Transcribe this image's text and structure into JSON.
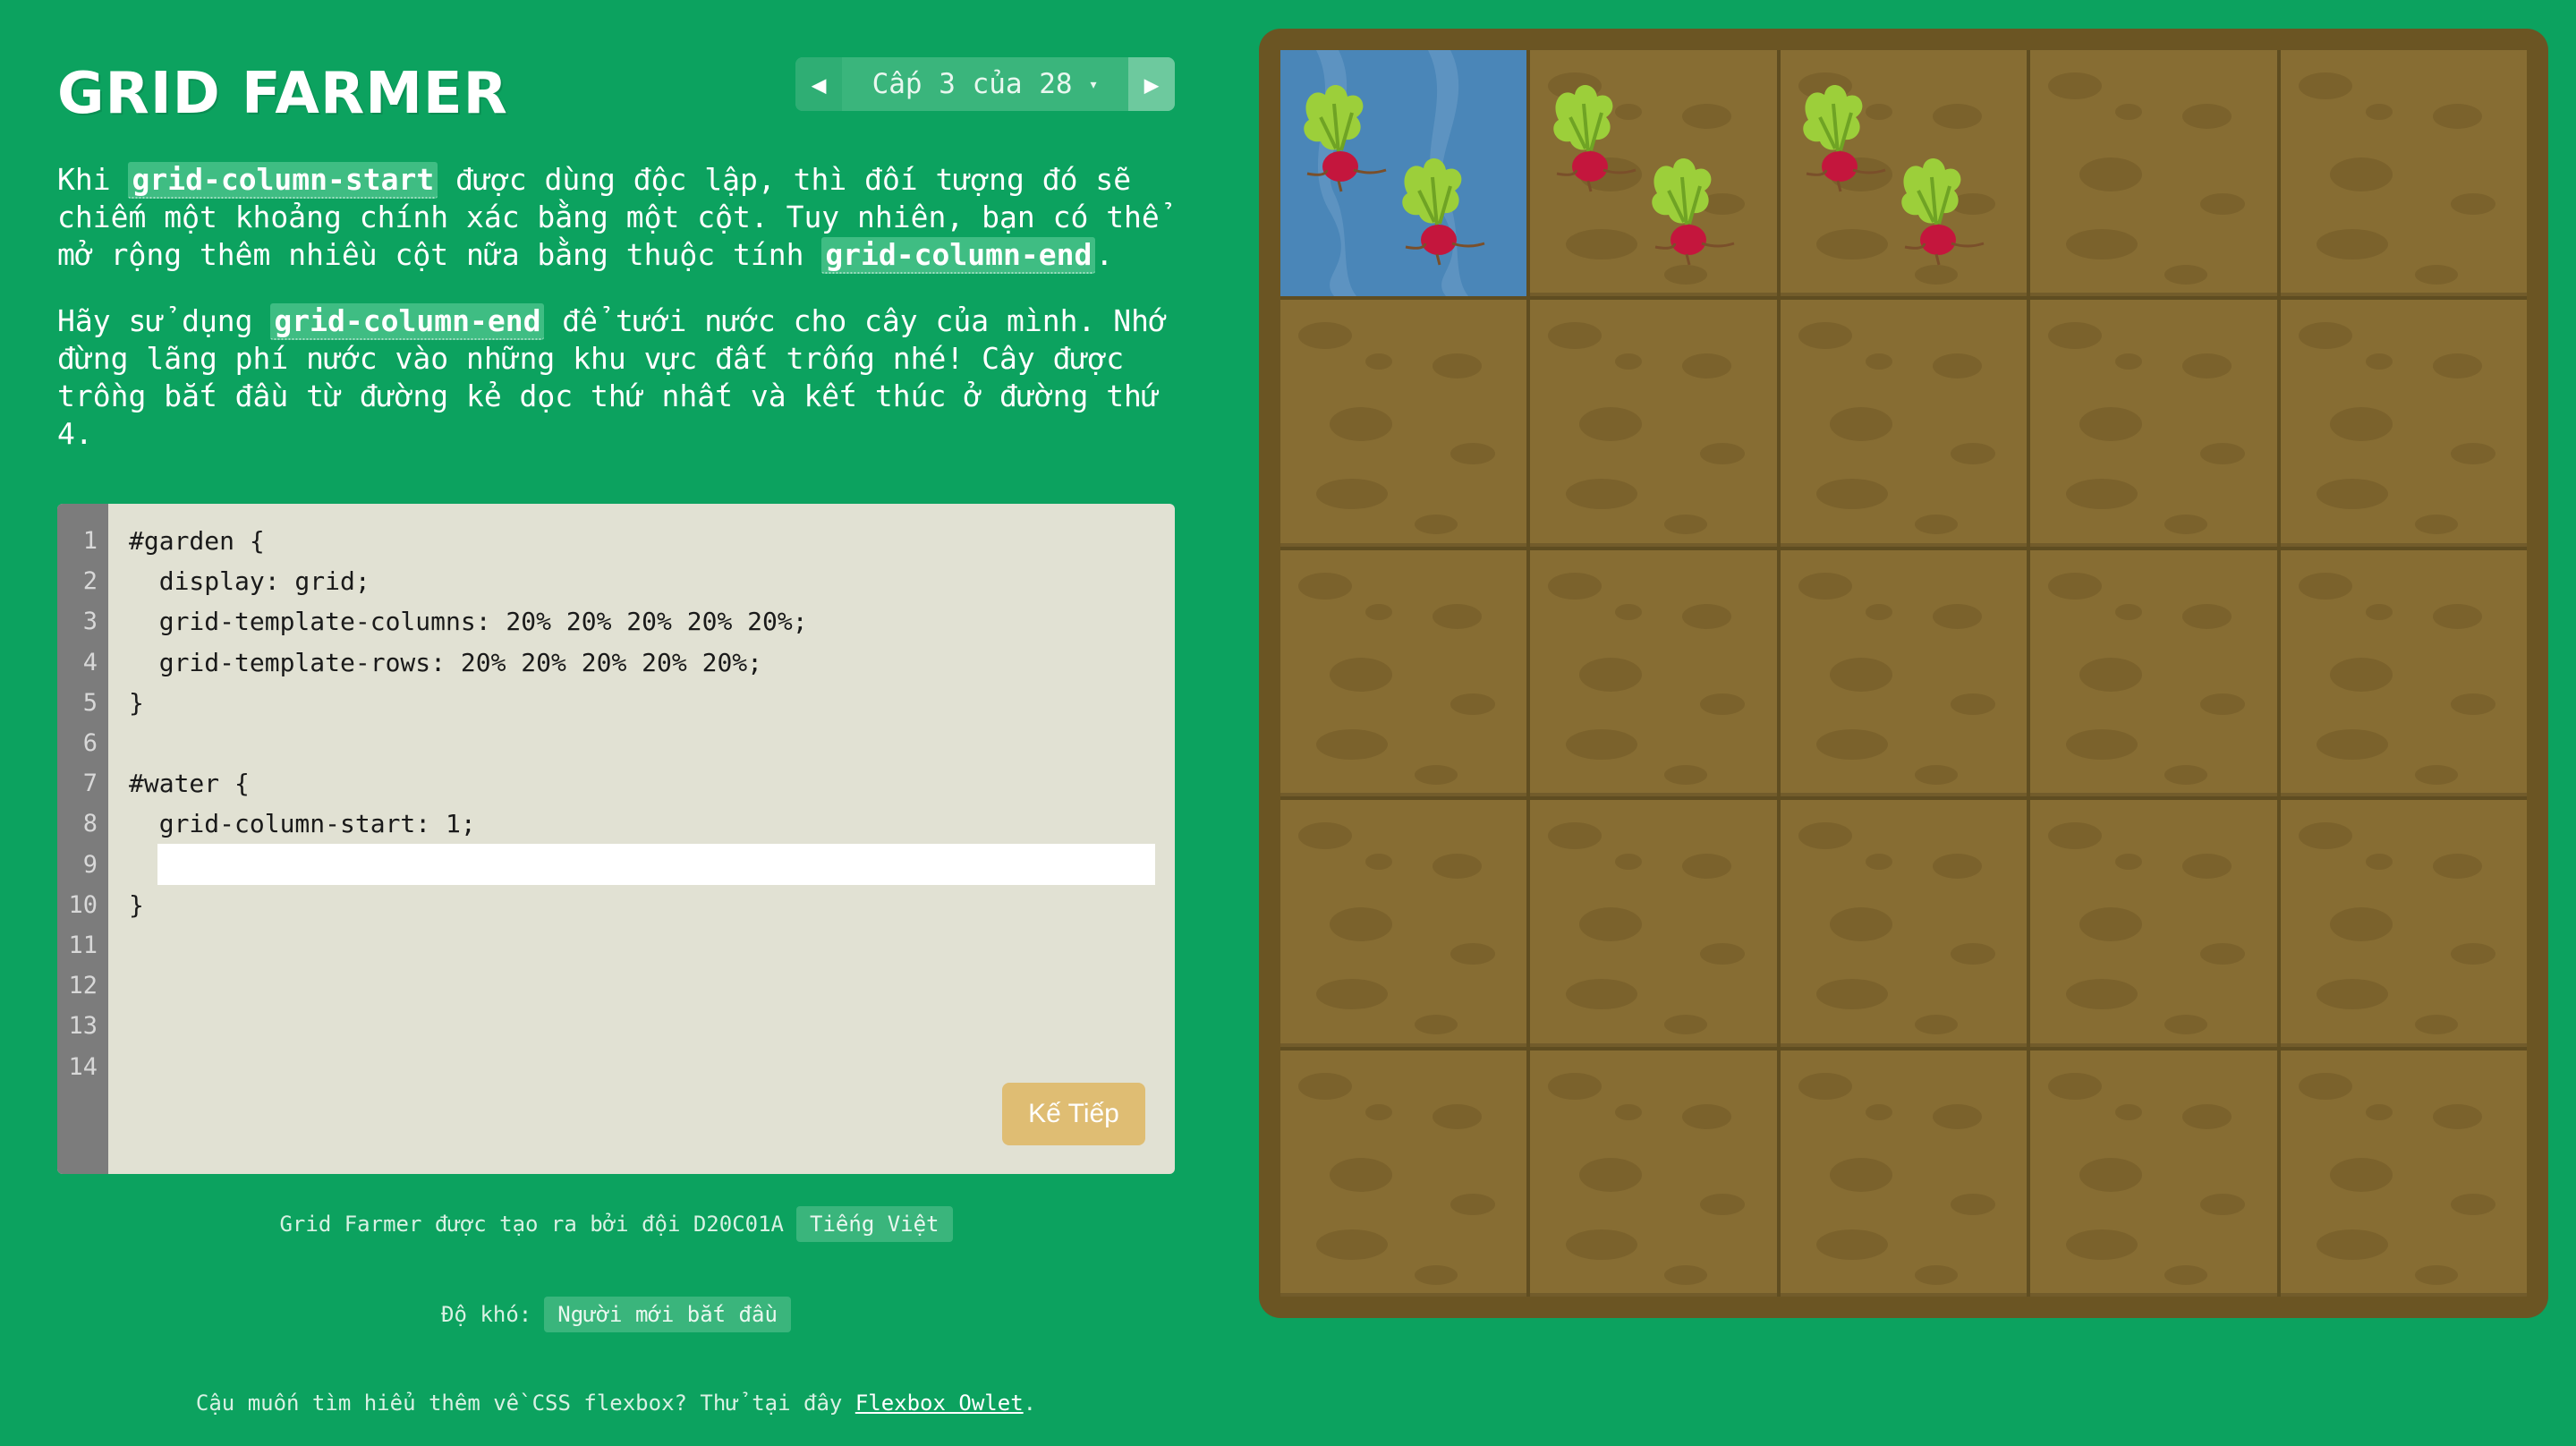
{
  "app": {
    "title": "GRID FARMER"
  },
  "level_nav": {
    "prev_icon": "triangle-left",
    "next_icon": "triangle-right",
    "label": "Cấp 3 của 28",
    "caret": "▾"
  },
  "instructions": {
    "p1": {
      "before": "Khi ",
      "code1": "grid-column-start",
      "middle": " được dùng độc lập, thì đối tượng đó sẽ chiếm một khoảng chính xác bằng một cột. Tuy nhiên, bạn có thể mở rộng thêm nhiều cột nữa bằng thuộc tính ",
      "code2": "grid-column-end",
      "after": "."
    },
    "p2": {
      "before": "Hãy sử dụng ",
      "code": "grid-column-end",
      "after": " để tưới nước cho cây của mình. Nhớ đừng lãng phí nước vào những khu vực đất trống nhé! Cây được trồng bắt đầu từ đường kẻ dọc thứ nhất và kết thúc ở đường thứ 4."
    }
  },
  "editor": {
    "line_numbers": [
      "1",
      "2",
      "3",
      "4",
      "5",
      "6",
      "7",
      "8",
      "9",
      "10",
      "11",
      "12",
      "13",
      "14"
    ],
    "lines": [
      "#garden {",
      "  display: grid;",
      "  grid-template-columns: 20% 20% 20% 20% 20%;",
      "  grid-template-rows: 20% 20% 20% 20% 20%;",
      "}",
      "",
      "#water {",
      "  grid-column-start: 1;",
      "",
      "}"
    ],
    "input_value": "",
    "input_placeholder": "",
    "next_label": "Kế Tiếp"
  },
  "footer": {
    "credits_text": "Grid Farmer được tạo ra bởi đội D20C01A",
    "language": "Tiếng Việt",
    "difficulty_label": "Độ khó:",
    "difficulty_value": "Người mới bắt đầu",
    "flexbox_text": "Cậu muốn tìm hiểu thêm về CSS flexbox? Thử tại đây",
    "flexbox_link": "Flexbox Owlet",
    "flexbox_end": "."
  },
  "garden": {
    "rows": 5,
    "columns": 5,
    "water_columns": 1,
    "carrot_cells": [
      "row 1, column 1",
      "row 1, column 2",
      "row 1, column 3"
    ],
    "colors": {
      "background": "#0ca25f",
      "soil": "#876d33",
      "frame": "#6b5523",
      "water": "#4a86b8",
      "leaf": "#9ccf3a",
      "root": "#c4163d"
    }
  }
}
